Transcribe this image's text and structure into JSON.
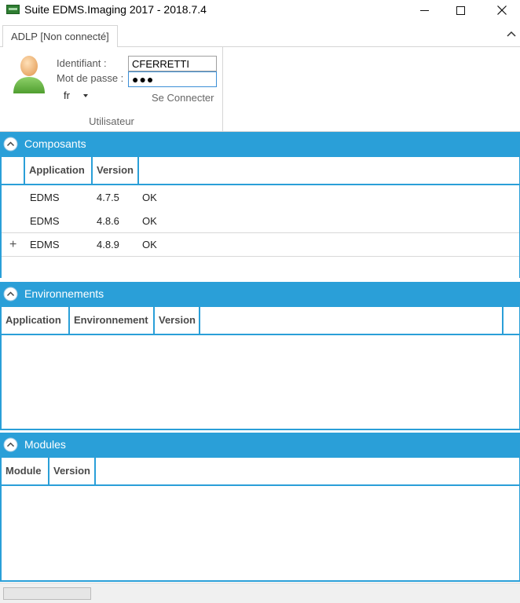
{
  "window": {
    "title": "Suite EDMS.Imaging 2017 - 2018.7.4"
  },
  "ribbon": {
    "tab_label": "ADLP [Non connecté]",
    "group_label": "Utilisateur",
    "identifiant_label": "Identifiant :",
    "identifiant_value": "CFERRETTI",
    "password_label": "Mot de passe :",
    "password_value": "●●●",
    "language": "fr",
    "connect_label": "Se Connecter"
  },
  "composants": {
    "title": "Composants",
    "columns": [
      "Application",
      "Version"
    ],
    "rows": [
      {
        "application": "EDMS",
        "version": "4.7.5",
        "status": "OK",
        "expandable": false
      },
      {
        "application": "EDMS",
        "version": "4.8.6",
        "status": "OK",
        "expandable": false
      },
      {
        "application": "EDMS",
        "version": "4.8.9",
        "status": "OK",
        "expandable": true
      }
    ],
    "expand_glyph": "+"
  },
  "environnements": {
    "title": "Environnements",
    "columns": [
      "Application",
      "Environnement",
      "Version"
    ]
  },
  "modules": {
    "title": "Modules",
    "columns": [
      "Module",
      "Version"
    ]
  },
  "statusbar": {
    "progress": 0
  },
  "icons": {
    "app": "edms-app-icon",
    "avatar": "user-avatar-icon",
    "collapse": "chevron-up-circle-icon"
  },
  "colors": {
    "accent": "#2a9fd8",
    "section_text": "#ffffff"
  }
}
